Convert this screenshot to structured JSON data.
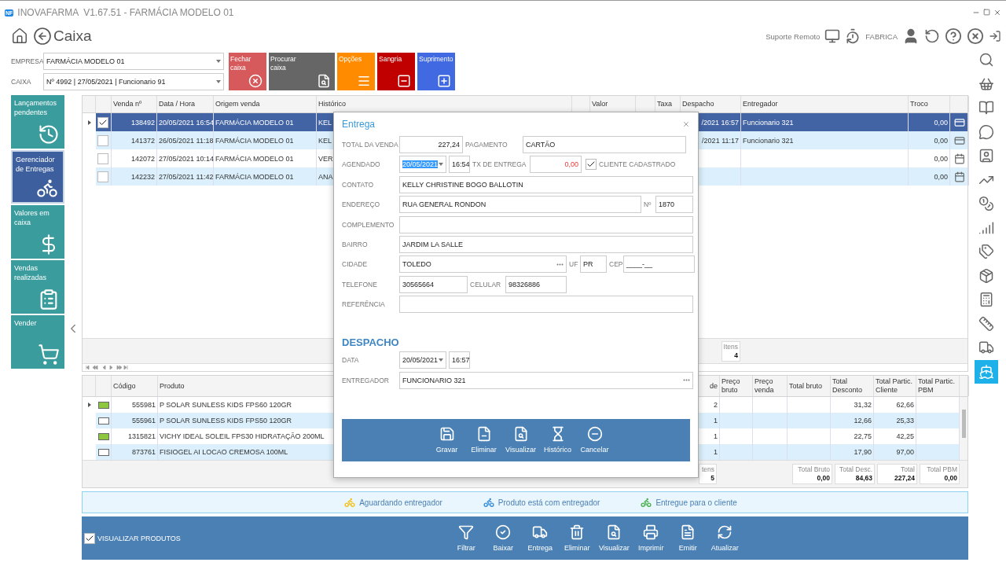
{
  "window": {
    "logo": "NF",
    "title": "INOVAFARMA  V1.67.51 - FARMÁCIA MODELO 01"
  },
  "page": {
    "title": "Caixa"
  },
  "header_right": {
    "remote_support": "Suporte Remoto",
    "user": "FABRICA"
  },
  "filters": [
    {
      "label": "EMPRESA",
      "value": "FARMÁCIA MODELO 01"
    },
    {
      "label": "CAIXA",
      "value": "Nº 4992 | 27/05/2021 | Funcionario 91"
    }
  ],
  "actions": [
    {
      "label": "Fechar caixa",
      "color": "#d65a5c"
    },
    {
      "label": "Procurar caixa",
      "color": "#666666"
    },
    {
      "label": "Opções",
      "color": "#ff8c00"
    },
    {
      "label": "Sangria",
      "color": "#c00000"
    },
    {
      "label": "Suprimento",
      "color": "#4169e1"
    }
  ],
  "left_menu": [
    {
      "label": "Lançamentos pendentes",
      "selected": false
    },
    {
      "label": "Gerenciador de Entregas",
      "selected": true
    },
    {
      "label": "Valores em caixa",
      "selected": false
    },
    {
      "label": "Vendas realizadas",
      "selected": false
    },
    {
      "label": "Vender",
      "selected": false
    }
  ],
  "right_toolbar": [
    {
      "selected": false
    },
    {
      "selected": false
    },
    {
      "selected": false
    },
    {
      "selected": false
    },
    {
      "selected": false
    },
    {
      "selected": false
    },
    {
      "selected": false
    },
    {
      "selected": false
    },
    {
      "selected": false
    },
    {
      "selected": false
    },
    {
      "selected": false
    },
    {
      "selected": false
    },
    {
      "selected": false
    },
    {
      "selected": true
    }
  ],
  "sales_grid": {
    "columns": [
      "Venda nº",
      "Data / Hora",
      "Origem venda",
      "Histórico",
      "Valor",
      "Taxa",
      "Despacho",
      "Entregador",
      "Troco"
    ],
    "rows": [
      {
        "selected": true,
        "current": true,
        "checked": true,
        "venda": "138492",
        "data_hora": "20/05/2021 16:54",
        "origem": "FARMÁCIA MODELO 01",
        "historico": "KEL",
        "despacho": "/2021 16:57",
        "entregador": "Funcionario 321",
        "troco": "0,00",
        "kind": "card"
      },
      {
        "selected": false,
        "current": false,
        "checked": false,
        "venda": "141372",
        "data_hora": "26/05/2021 11:18",
        "origem": "FARMÁCIA MODELO 01",
        "historico": "KEL",
        "despacho": "/2021 11:17",
        "entregador": "Funcionario 321",
        "troco": "0,00",
        "kind": "card"
      },
      {
        "selected": false,
        "current": false,
        "checked": false,
        "venda": "142072",
        "data_hora": "27/05/2021 10:14",
        "origem": "FARMÁCIA MODELO 01",
        "historico": "VER",
        "troco": "0,00",
        "kind": "calendar"
      },
      {
        "selected": false,
        "current": false,
        "checked": false,
        "venda": "142232",
        "data_hora": "27/05/2021 11:42",
        "origem": "FARMÁCIA MODELO 01",
        "historico": "ANA",
        "troco": "0,00",
        "kind": "calendar"
      }
    ],
    "footer": {
      "label": "Itens",
      "value": "4"
    }
  },
  "products_grid": {
    "columns": [
      "Código",
      "Produto",
      "de",
      "Preço bruto",
      "Preço venda",
      "Total bruto",
      "Total Desconto",
      "Total Partic. Cliente",
      "Total Partic. PBM"
    ],
    "rows": [
      {
        "current": true,
        "flagged": true,
        "codigo": "555981",
        "produto": "P SOLAR SUNLESS KIDS FPS60 120GR",
        "qtd": "2",
        "total_desconto": "31,32",
        "total_cliente": "62,66"
      },
      {
        "current": false,
        "flagged": false,
        "codigo": "555961",
        "produto": "P SOLAR SUNLESS KIDS FPS50 120GR",
        "qtd": "1",
        "total_desconto": "12,66",
        "total_cliente": "25,33"
      },
      {
        "current": false,
        "flagged": true,
        "codigo": "1315821",
        "produto": "VICHY IDEAL SOLEIL FPS30 HIDRATAÇÃO 200ML",
        "qtd": "1",
        "total_desconto": "22,75",
        "total_cliente": "42,25"
      },
      {
        "current": false,
        "flagged": false,
        "codigo": "873761",
        "produto": "FISIOGEL AI LOCAO CREMOSA 100ML",
        "qtd": "1",
        "total_desconto": "17,90",
        "total_cliente": "97,00"
      }
    ],
    "footer": {
      "items": {
        "label": "tens",
        "value": "5"
      },
      "totals": [
        {
          "label": "Total Bruto",
          "value": "0,00"
        },
        {
          "label": "Total Desc.",
          "value": "84,63"
        },
        {
          "label": "Total",
          "value": "227,24"
        },
        {
          "label": "Total PBM",
          "value": "0,00"
        }
      ]
    }
  },
  "legend": [
    {
      "label": "Aguardando entregador",
      "color": "#f2c21b"
    },
    {
      "label": "Produto está com entregador",
      "color": "#3a8fd8"
    },
    {
      "label": "Entregue para o cliente",
      "color": "#4cb050"
    }
  ],
  "toolbar": {
    "show_products": {
      "label": "VISUALIZAR PRODUTOS",
      "checked": true
    },
    "buttons": [
      "Filtrar",
      "Baixar",
      "Entrega",
      "Eliminar",
      "Visualizar",
      "Imprimir",
      "Emitir",
      "Atualizar"
    ]
  },
  "dialog": {
    "title": "Entrega",
    "total": {
      "label": "TOTAL DA VENDA",
      "value": "227,24"
    },
    "payment": {
      "label": "PAGAMENTO",
      "value": "CARTÃO"
    },
    "scheduled": {
      "label": "AGENDADO",
      "date": "20/05/2021",
      "date_highlighted": true,
      "time": "16:54"
    },
    "fee": {
      "label": "TX DE ENTREGA",
      "value": "0,00"
    },
    "registered": {
      "label": "CLIENTE CADASTRADO",
      "checked": true
    },
    "contact": {
      "label": "CONTATO",
      "value": "KELLY CHRISTINE BOGO BALLOTIN"
    },
    "address": {
      "label": "ENDEREÇO",
      "value": "RUA GENERAL RONDON",
      "number_label": "Nº",
      "number": "1870"
    },
    "complement": {
      "label": "COMPLEMENTO"
    },
    "district": {
      "label": "BAIRRO",
      "value": "JARDIM LA SALLE"
    },
    "city": {
      "label": "CIDADE",
      "value": "TOLEDO",
      "uf_label": "UF",
      "uf": "PR",
      "cep_label": "CEP",
      "cep": "____-__"
    },
    "phone": {
      "label": "TELEFONE",
      "value": "30565664",
      "mobile_label": "CELULAR",
      "mobile": "98326886"
    },
    "reference": {
      "label": "REFERÊNCIA"
    },
    "dispatch": {
      "heading": "DESPACHO",
      "date_label": "DATA",
      "date": "20/05/2021",
      "time": "16:57",
      "courier_label": "ENTREGADOR",
      "courier": "FUNCIONARIO 321"
    },
    "buttons": [
      "Gravar",
      "Eliminar",
      "Visualizar",
      "Histórico",
      "Cancelar"
    ]
  }
}
